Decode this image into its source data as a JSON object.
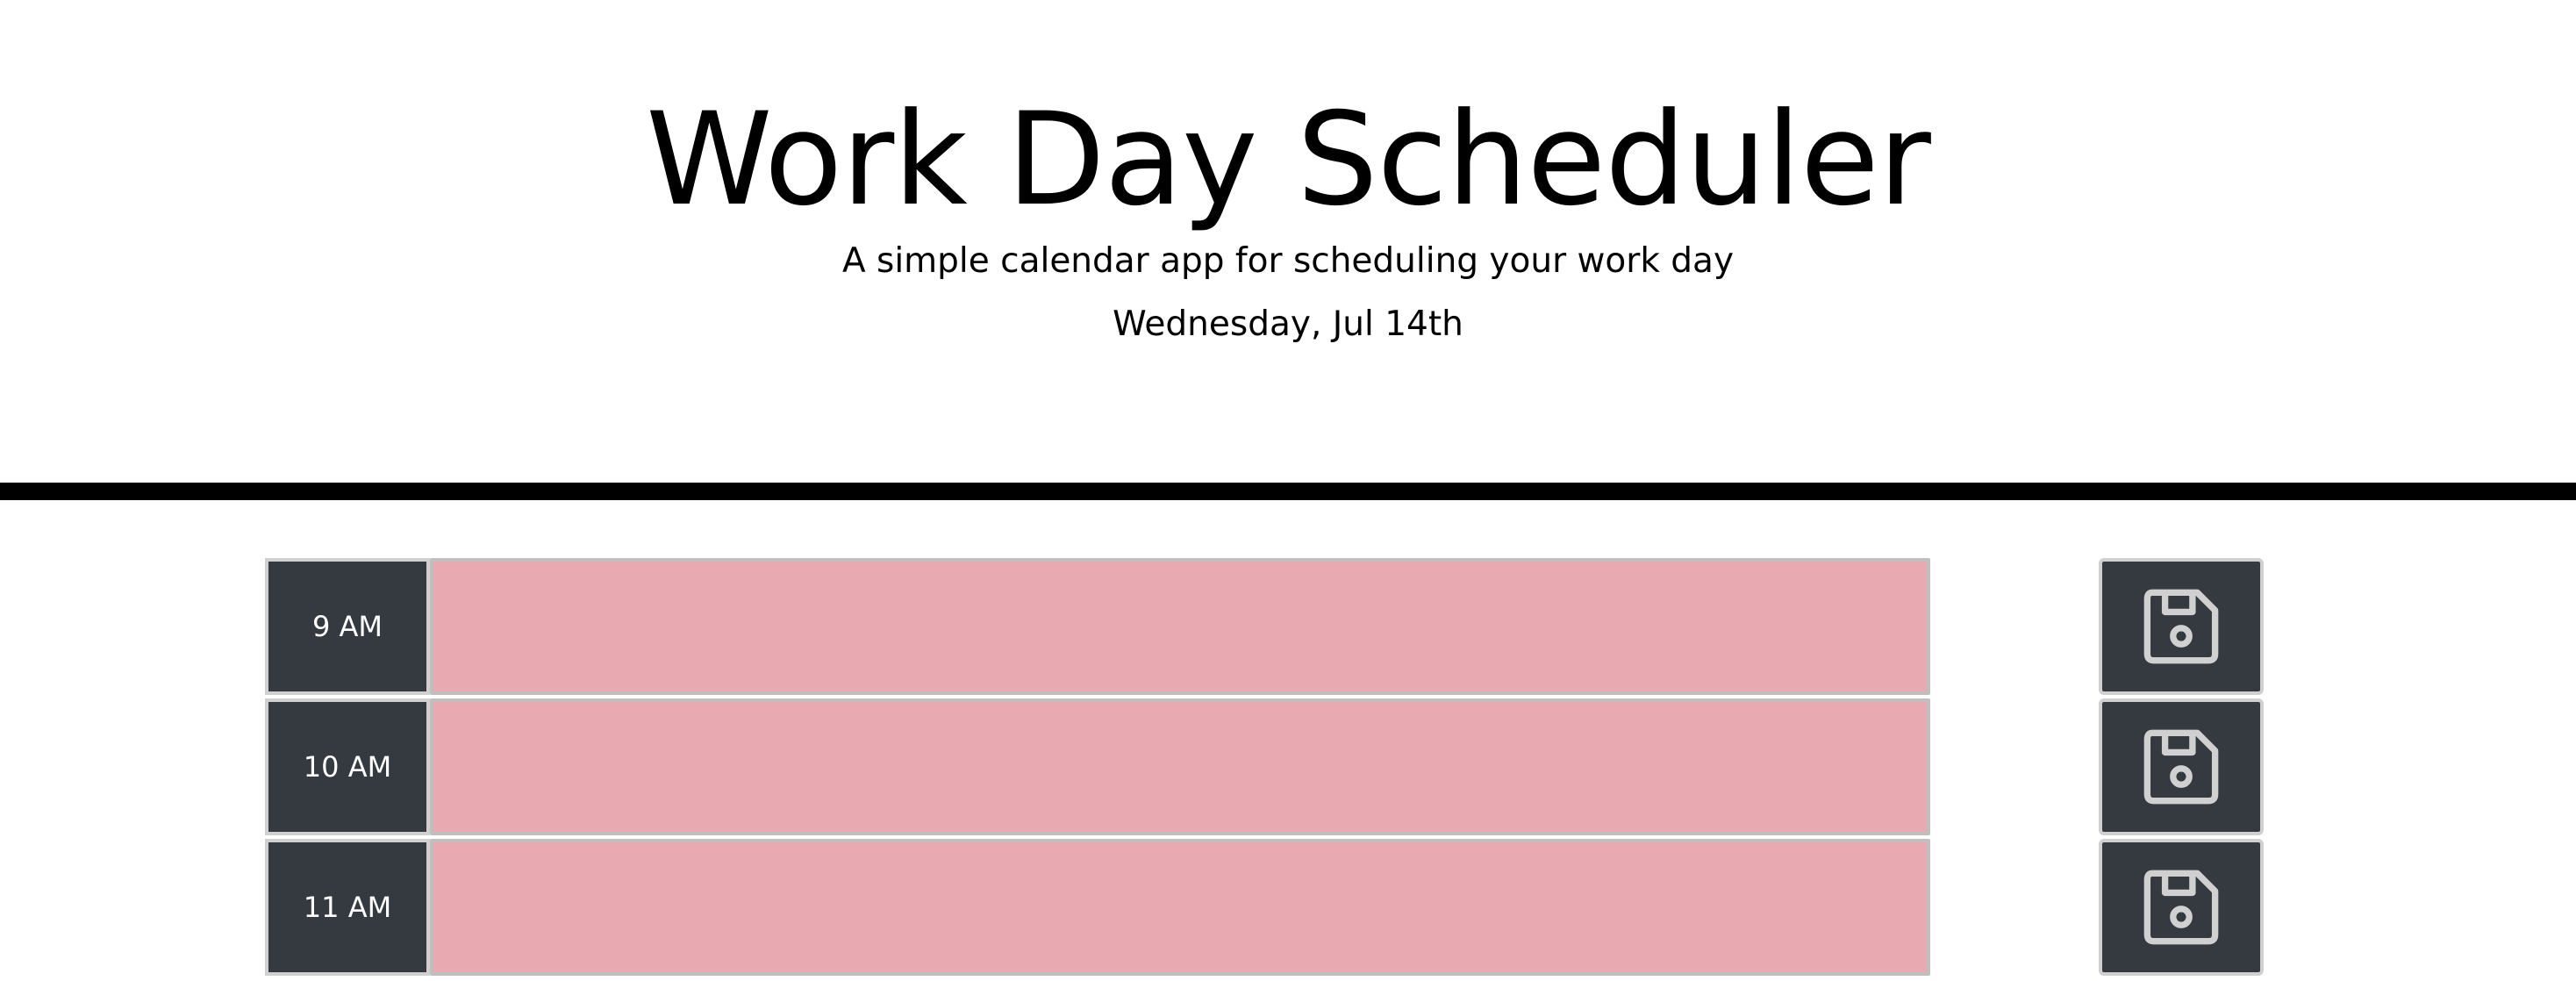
{
  "header": {
    "title": "Work Day Scheduler",
    "subtitle": "A simple calendar app for scheduling your work day",
    "current_date": "Wednesday, Jul 14th"
  },
  "time_blocks": [
    {
      "hour": "9 AM",
      "description": "",
      "status": "past",
      "status_color": "#e8a9b0",
      "save_icon": "floppy-disk-icon"
    },
    {
      "hour": "10 AM",
      "description": "",
      "status": "past",
      "status_color": "#e8a9b0",
      "save_icon": "floppy-disk-icon"
    },
    {
      "hour": "11 AM",
      "description": "",
      "status": "past",
      "status_color": "#e8a9b0",
      "save_icon": "floppy-disk-icon"
    }
  ],
  "colors": {
    "hour_bg": "#343a40",
    "divider": "#000000",
    "past": "#e8a9b0",
    "save_icon": "#d0d0d0"
  }
}
